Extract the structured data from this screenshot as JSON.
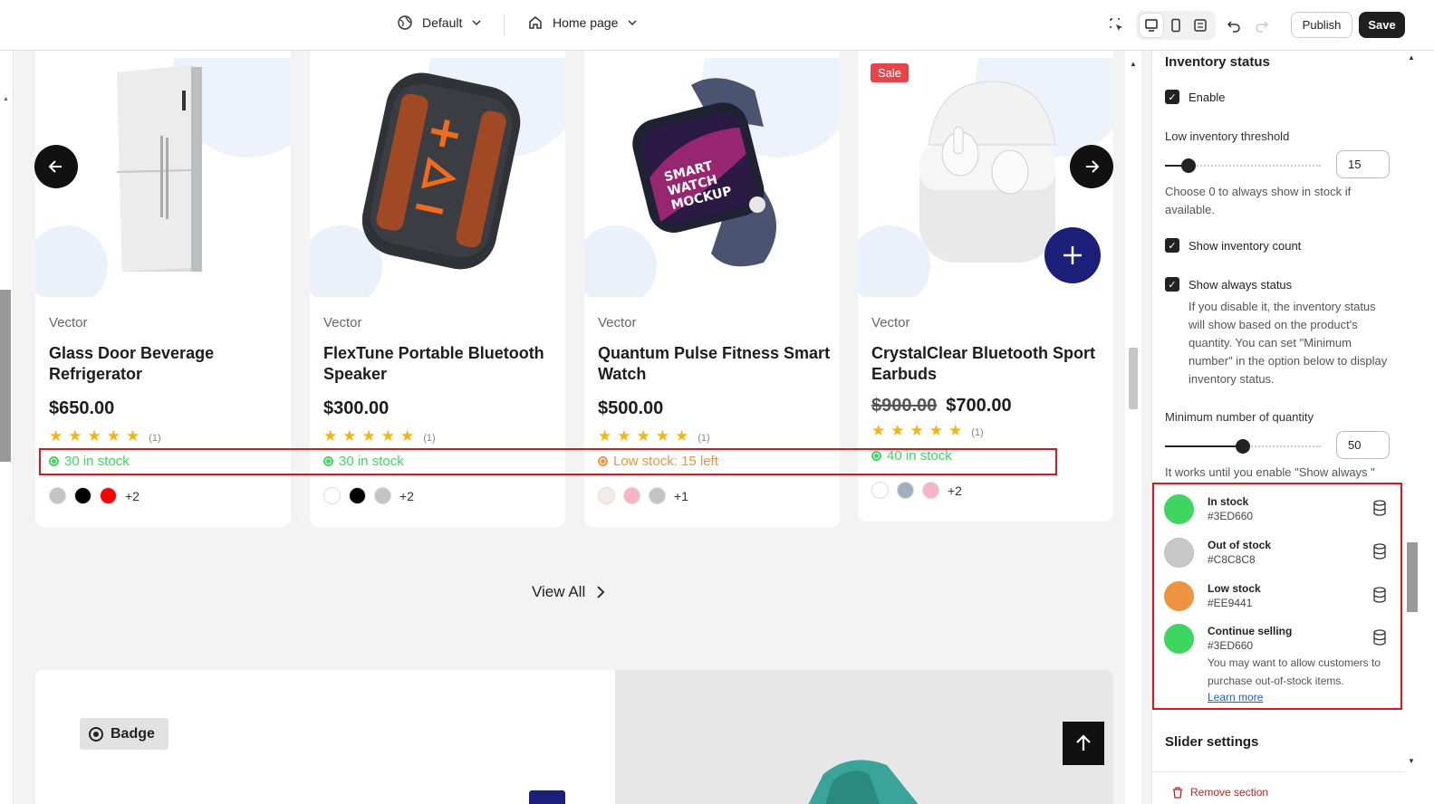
{
  "topbar": {
    "theme_label": "Default",
    "page_label": "Home page",
    "publish_label": "Publish",
    "save_label": "Save"
  },
  "products": [
    {
      "vendor": "Vector",
      "name": "Glass Door Beverage Refrigerator",
      "price": "$650.00",
      "old_price": "",
      "rating": 5,
      "review_count": "(1)",
      "stock_text": "30 in stock",
      "stock_color": "#3ED660",
      "swatches": [
        "#c4c4c4",
        "#000000",
        "#ff0000"
      ],
      "more_colors": "+2",
      "sale": ""
    },
    {
      "vendor": "Vector",
      "name": "FlexTune Portable Bluetooth Speaker",
      "price": "$300.00",
      "old_price": "",
      "rating": 5,
      "review_count": "(1)",
      "stock_text": "30 in stock",
      "stock_color": "#3ED660",
      "swatches": [
        "#ffffff",
        "#000000",
        "#c4c4c4"
      ],
      "more_colors": "+2",
      "sale": ""
    },
    {
      "vendor": "Vector",
      "name": "Quantum Pulse Fitness Smart Watch",
      "price": "$500.00",
      "old_price": "",
      "rating": 5,
      "review_count": "(1)",
      "stock_text": "Low stock: 15 left",
      "stock_color": "#EE9441",
      "swatches": [
        "#f7eaea",
        "#f7b4c4",
        "#c4c4c4"
      ],
      "more_colors": "+1",
      "sale": ""
    },
    {
      "vendor": "Vector",
      "name": "CrystalClear Bluetooth Sport Earbuds",
      "price": "$700.00",
      "old_price": "$900.00",
      "rating": 5,
      "review_count": "(1)",
      "stock_text": "40 in stock",
      "stock_color": "#3ED660",
      "swatches": [
        "#ffffff",
        "#9fb0c0",
        "#f7b4c4"
      ],
      "more_colors": "+2",
      "sale": "Sale"
    }
  ],
  "view_all_label": "View All",
  "badge_label": "Badge",
  "panel": {
    "title": "Inventory status",
    "enable_label": "Enable",
    "threshold_label": "Low inventory threshold",
    "threshold_value": "15",
    "threshold_fraction": 0.15,
    "threshold_help": "Choose 0 to always show in stock if available.",
    "show_count_label": "Show inventory count",
    "show_always_label": "Show always status",
    "show_always_help": "If you disable it, the inventory status will show based on the product's quantity. You can set \"Minimum number\" in the option below to display inventory status.",
    "min_label": "Minimum number of quantity",
    "min_value": "50",
    "min_fraction": 0.5,
    "min_help": "It works until you enable \"Show always \"",
    "colors": [
      {
        "name": "In stock",
        "hex": "#3ED660"
      },
      {
        "name": "Out of stock",
        "hex": "#C8C8C8"
      },
      {
        "name": "Low stock",
        "hex": "#EE9441"
      },
      {
        "name": "Continue selling",
        "hex": "#3ED660"
      }
    ],
    "continue_help": "You may want to allow customers to purchase out-of-stock items.",
    "learn_more": "Learn more",
    "slider_settings": "Slider settings",
    "remove_section": "Remove section"
  }
}
